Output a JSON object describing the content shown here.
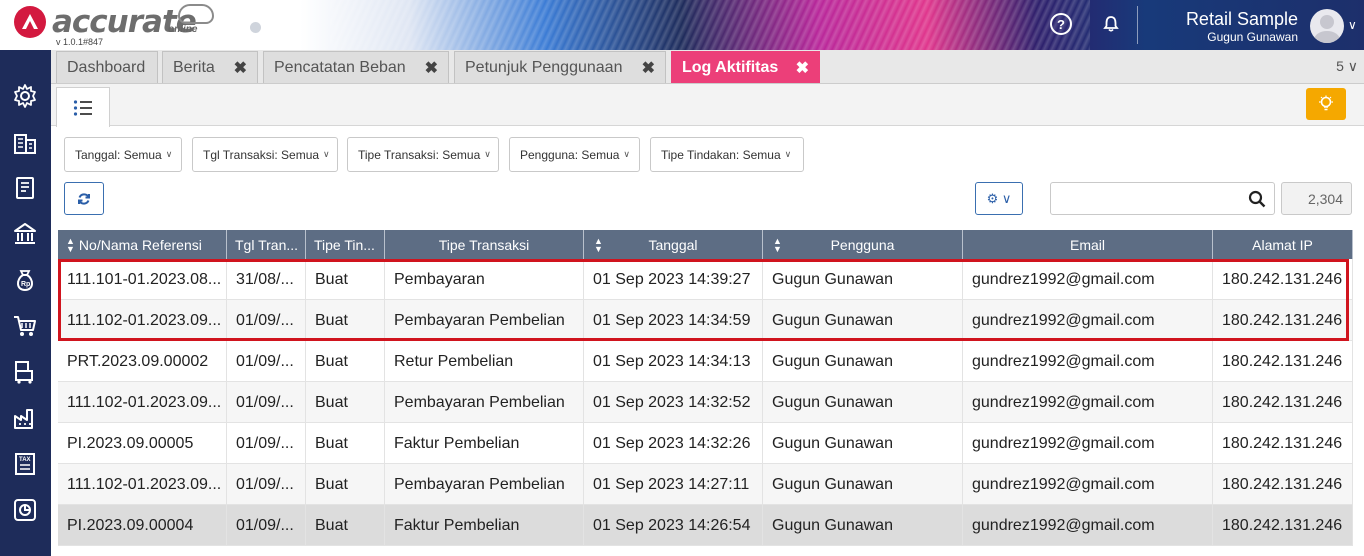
{
  "header": {
    "logo_text": "accurate",
    "logo_sub": "online",
    "version": "v 1.0.1#847",
    "company_name": "Retail Sample",
    "user_name": "Gugun Gunawan",
    "help_icon": "help-icon",
    "bell_icon": "bell-icon"
  },
  "tabs": [
    {
      "label": "Dashboard",
      "closable": false,
      "active": false
    },
    {
      "label": "Berita",
      "closable": true,
      "active": false
    },
    {
      "label": "Pencatatan Beban",
      "closable": true,
      "active": false
    },
    {
      "label": "Petunjuk Penggunaan",
      "closable": true,
      "active": false
    },
    {
      "label": "Log Aktifitas",
      "closable": true,
      "active": true
    }
  ],
  "tab_count": "5",
  "close_glyph": "✖",
  "filters": [
    {
      "label": "Tanggal: Semua"
    },
    {
      "label": "Tgl Transaksi: Semua"
    },
    {
      "label": "Tipe Transaksi: Semua"
    },
    {
      "label": "Pengguna: Semua"
    },
    {
      "label": "Tipe Tindakan: Semua"
    }
  ],
  "toolbar": {
    "search_placeholder": "",
    "record_count": "2,304"
  },
  "table": {
    "columns": [
      "No/Nama Referensi",
      "Tgl Tran...",
      "Tipe Tin...",
      "Tipe Transaksi",
      "Tanggal",
      "Pengguna",
      "Email",
      "Alamat IP"
    ],
    "rows": [
      [
        "111.101-01.2023.08...",
        "31/08/...",
        "Buat",
        "Pembayaran",
        "01 Sep 2023 14:39:27",
        "Gugun Gunawan",
        "gundrez1992@gmail.com",
        "180.242.131.246"
      ],
      [
        "111.102-01.2023.09...",
        "01/09/...",
        "Buat",
        "Pembayaran Pembelian",
        "01 Sep 2023 14:34:59",
        "Gugun Gunawan",
        "gundrez1992@gmail.com",
        "180.242.131.246"
      ],
      [
        "PRT.2023.09.00002",
        "01/09/...",
        "Buat",
        "Retur Pembelian",
        "01 Sep 2023 14:34:13",
        "Gugun Gunawan",
        "gundrez1992@gmail.com",
        "180.242.131.246"
      ],
      [
        "111.102-01.2023.09...",
        "01/09/...",
        "Buat",
        "Pembayaran Pembelian",
        "01 Sep 2023 14:32:52",
        "Gugun Gunawan",
        "gundrez1992@gmail.com",
        "180.242.131.246"
      ],
      [
        "PI.2023.09.00005",
        "01/09/...",
        "Buat",
        "Faktur Pembelian",
        "01 Sep 2023 14:32:26",
        "Gugun Gunawan",
        "gundrez1992@gmail.com",
        "180.242.131.246"
      ],
      [
        "111.102-01.2023.09...",
        "01/09/...",
        "Buat",
        "Pembayaran Pembelian",
        "01 Sep 2023 14:27:11",
        "Gugun Gunawan",
        "gundrez1992@gmail.com",
        "180.242.131.246"
      ],
      [
        "PI.2023.09.00004",
        "01/09/...",
        "Buat",
        "Faktur Pembelian",
        "01 Sep 2023 14:26:54",
        "Gugun Gunawan",
        "gundrez1992@gmail.com",
        "180.242.131.246"
      ]
    ]
  },
  "sidebar_icons": [
    "settings-icon",
    "company-icon",
    "ledger-icon",
    "bank-icon",
    "cash-bag-icon",
    "cart-icon",
    "inventory-icon",
    "factory-icon",
    "tax-icon",
    "report-icon"
  ],
  "colors": {
    "brand_red": "#d3193f",
    "active_tab": "#ec3f79",
    "nav_bg": "#1e2c5a",
    "table_header": "#5d6d84",
    "bulb_button": "#f5a800",
    "highlight_border": "#d0141e"
  }
}
